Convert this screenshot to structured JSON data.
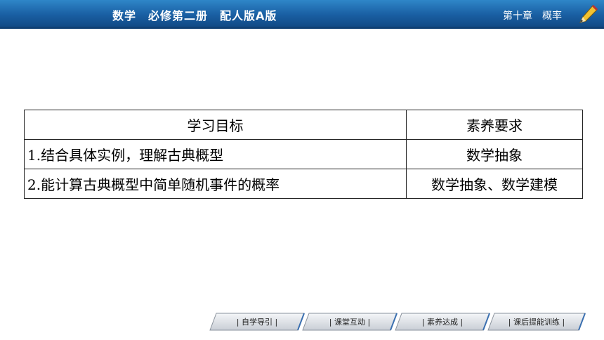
{
  "header": {
    "title": "数学　必修第二册　配人版A版",
    "chapter": "第十章　概率"
  },
  "table": {
    "headers": [
      "学习目标",
      "素养要求"
    ],
    "rows": [
      {
        "goal": "1.结合具体实例，理解古典概型",
        "requirement": "数学抽象"
      },
      {
        "goal": "2.能计算古典概型中简单随机事件的概率",
        "requirement": "数学抽象、数学建模"
      }
    ]
  },
  "nav": {
    "items": [
      {
        "label": "| 自学导引 |"
      },
      {
        "label": "| 课堂互动 |"
      },
      {
        "label": "| 素养达成 |"
      },
      {
        "label": "| 课后提能训练 |"
      }
    ]
  },
  "colors": {
    "header_blue": "#1a5fa3",
    "nav_button": "#dfe3e8"
  }
}
